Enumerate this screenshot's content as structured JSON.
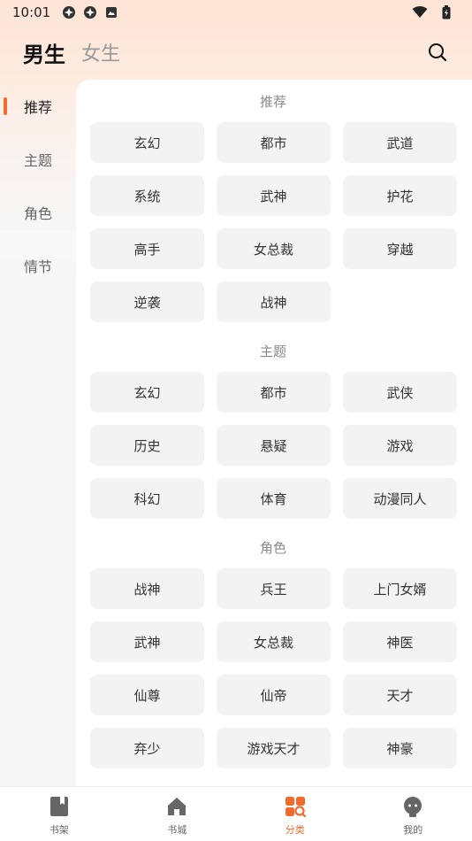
{
  "status_bar": {
    "time": "10:01"
  },
  "header": {
    "tab_male": "男生",
    "tab_female": "女生"
  },
  "sidebar": {
    "items": [
      {
        "label": "推荐",
        "active": true
      },
      {
        "label": "主题",
        "active": false
      },
      {
        "label": "角色",
        "active": false
      },
      {
        "label": "情节",
        "active": false
      }
    ]
  },
  "sections": [
    {
      "title": "推荐",
      "tags": [
        "玄幻",
        "都市",
        "武道",
        "系统",
        "武神",
        "护花",
        "高手",
        "女总裁",
        "穿越",
        "逆袭",
        "战神"
      ]
    },
    {
      "title": "主题",
      "tags": [
        "玄幻",
        "都市",
        "武侠",
        "历史",
        "悬疑",
        "游戏",
        "科幻",
        "体育",
        "动漫同人"
      ]
    },
    {
      "title": "角色",
      "tags": [
        "战神",
        "兵王",
        "上门女婿",
        "武神",
        "女总裁",
        "神医",
        "仙尊",
        "仙帝",
        "天才",
        "弃少",
        "游戏天才",
        "神豪"
      ]
    }
  ],
  "bottom_nav": {
    "items": [
      {
        "label": "书架",
        "icon": "bookshelf-icon"
      },
      {
        "label": "书城",
        "icon": "home-icon"
      },
      {
        "label": "分类",
        "icon": "category-icon"
      },
      {
        "label": "我的",
        "icon": "profile-icon"
      }
    ],
    "active_index": 2
  },
  "colors": {
    "accent": "#f26a2e",
    "tag_bg": "#f3f3f3",
    "header_gradient_top": "#fde4d6"
  }
}
